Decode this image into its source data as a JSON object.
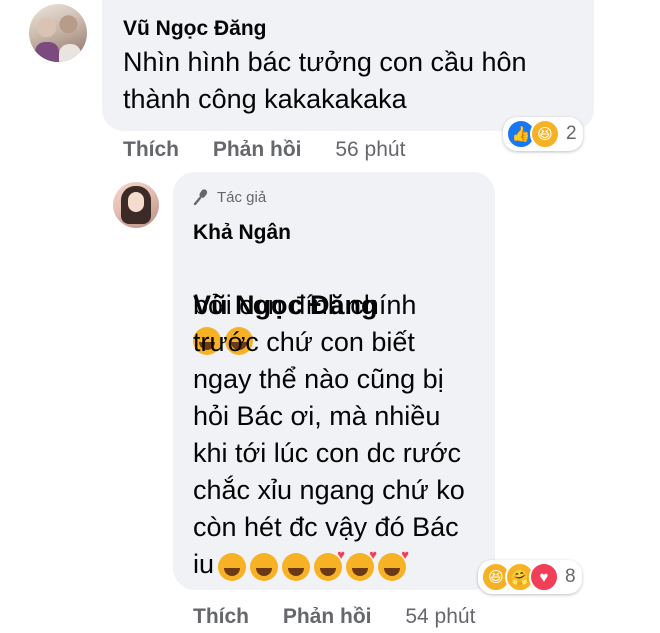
{
  "comment1": {
    "author": "Vũ Ngọc Đăng",
    "text": "Nhìn hình bác tưởng con cầu hôn\nthành công kakakakaka",
    "actions": {
      "like": "Thích",
      "reply": "Phản hồi",
      "time": "56 phút"
    },
    "reactions": {
      "icons": [
        "like-icon",
        "haha-icon"
      ],
      "count": "2"
    }
  },
  "reply1": {
    "badge": "Tác giả",
    "author": "Khả Ngân",
    "mention": "Vũ Ngọc Đăng",
    "text": "bởi con đính chính\ntrước chứ con biết\nngay thể nào cũng bị\nhỏi Bác ơi, mà nhiều\nkhi tới lúc con dc rước\nchắc xỉu ngang chứ ko\ncòn hét đc vậy đó Bác\niu",
    "actions": {
      "like": "Thích",
      "reply": "Phản hồi",
      "time": "54 phút"
    },
    "reactions": {
      "icons": [
        "haha-icon",
        "care-icon",
        "love-icon"
      ],
      "count": "8"
    }
  },
  "colors": {
    "bubble": "#f0f2f5",
    "secondary_text": "#65676b",
    "like_blue": "#1877f2",
    "haha_yellow": "#f7b125",
    "love_red": "#f33e58"
  }
}
